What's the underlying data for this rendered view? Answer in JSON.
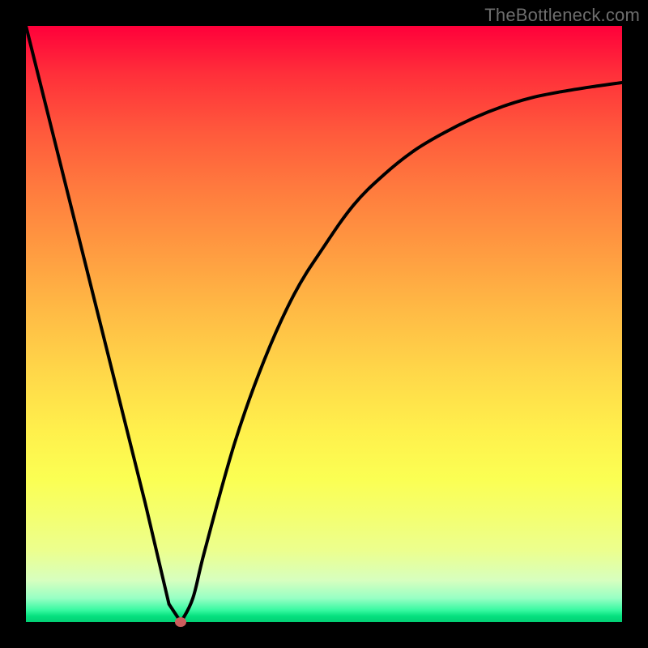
{
  "watermark": "TheBottleneck.com",
  "chart_data": {
    "type": "line",
    "title": "",
    "xlabel": "",
    "ylabel": "",
    "xlim": [
      0,
      100
    ],
    "ylim": [
      0,
      100
    ],
    "grid": false,
    "legend": false,
    "series": [
      {
        "name": "curve",
        "x": [
          0,
          5,
          10,
          15,
          20,
          24,
          26,
          28,
          30,
          35,
          40,
          45,
          50,
          55,
          60,
          65,
          70,
          75,
          80,
          85,
          90,
          95,
          100
        ],
        "y": [
          100,
          80,
          60,
          40,
          20,
          3,
          0,
          4,
          12,
          30,
          44,
          55,
          63,
          70,
          75,
          79,
          82,
          84.5,
          86.5,
          88,
          89,
          89.8,
          90.5
        ]
      }
    ],
    "marker": {
      "x": 26,
      "y": 0,
      "color": "#cc5d5d"
    },
    "gradient": {
      "top": "#ff003a",
      "mid": "#ffd749",
      "bottom": "#02cf74"
    }
  }
}
